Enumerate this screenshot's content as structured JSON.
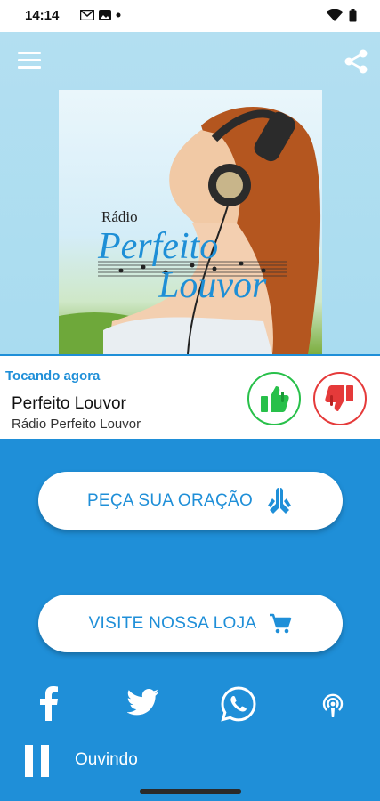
{
  "status_bar": {
    "time": "14:14",
    "icons": [
      "gmail-icon",
      "photos-icon",
      "dot-icon",
      "wifi-icon",
      "battery-icon"
    ]
  },
  "header": {
    "menu_icon": "hamburger-menu-icon",
    "share_icon": "share-icon"
  },
  "cover": {
    "logo_radio": "Rádio",
    "logo_line1": "Perfeito",
    "logo_line2": "Louvor"
  },
  "now_playing": {
    "label": "Tocando agora",
    "title": "Perfeito Louvor",
    "artist": "Rádio Perfeito Louvor",
    "like_icon": "thumbs-up-icon",
    "dislike_icon": "thumbs-down-icon"
  },
  "actions": {
    "prayer_label": "PEÇA SUA ORAÇÃO",
    "prayer_icon": "praying-hands-icon",
    "store_label": "VISITE NOSSA LOJA",
    "store_icon": "shopping-cart-icon"
  },
  "social": {
    "icons": [
      "facebook-icon",
      "twitter-icon",
      "whatsapp-icon",
      "podcast-icon"
    ]
  },
  "player": {
    "status": "Ouvindo",
    "control_icon": "pause-icon"
  },
  "colors": {
    "primary": "#1f8fd8",
    "like": "#28c04a",
    "dislike": "#e53a3a",
    "background": "#ffffff"
  }
}
